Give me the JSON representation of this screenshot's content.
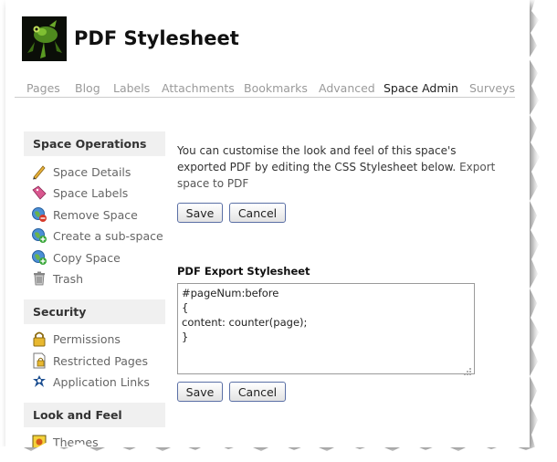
{
  "header": {
    "title": "PDF Stylesheet",
    "logo_icon": "frog-logo-icon"
  },
  "tabs": [
    {
      "label": "Pages"
    },
    {
      "label": "Blog"
    },
    {
      "label": "Labels"
    },
    {
      "label": "Attachments"
    },
    {
      "label": "Bookmarks"
    },
    {
      "label": "Advanced"
    },
    {
      "label": "Space Admin",
      "active": true
    },
    {
      "label": "Surveys"
    }
  ],
  "sidebar": {
    "sections": [
      {
        "heading": "Space Operations",
        "items": [
          {
            "label": "Space Details",
            "icon": "pencil-icon"
          },
          {
            "label": "Space Labels",
            "icon": "tag-icon"
          },
          {
            "label": "Remove Space",
            "icon": "globe-remove-icon"
          },
          {
            "label": "Create a sub-space",
            "icon": "globe-add-icon"
          },
          {
            "label": "Copy Space",
            "icon": "globe-copy-icon"
          },
          {
            "label": "Trash",
            "icon": "trash-icon"
          }
        ]
      },
      {
        "heading": "Security",
        "items": [
          {
            "label": "Permissions",
            "icon": "lock-icon"
          },
          {
            "label": "Restricted Pages",
            "icon": "restricted-page-icon"
          },
          {
            "label": "Application Links",
            "icon": "app-links-icon"
          }
        ]
      },
      {
        "heading": "Look and Feel",
        "items": [
          {
            "label": "Themes",
            "icon": "theme-icon"
          }
        ]
      }
    ]
  },
  "main": {
    "description": "You can customise the look and feel of this space's exported PDF by editing the CSS Stylesheet below.",
    "export_link": "Export space to PDF",
    "save_label": "Save",
    "cancel_label": "Cancel",
    "stylesheet_label": "PDF Export Stylesheet",
    "stylesheet_value": "#pageNum:before\n{\ncontent: counter(page);\n}"
  },
  "colors": {
    "button_border": "#5a6fa5",
    "tab_inactive": "#9a9a9a",
    "sidebar_head_bg": "#f0f0f0"
  }
}
